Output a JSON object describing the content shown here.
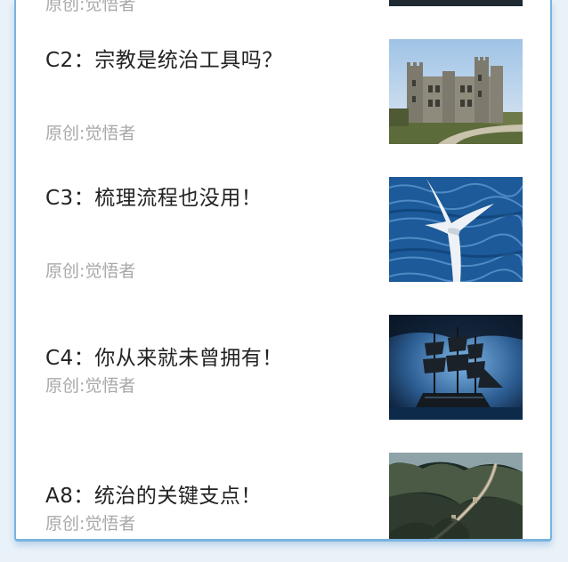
{
  "partial_item": {
    "author": "原创:觉悟者"
  },
  "articles": [
    {
      "title": "C2：宗教是统治工具吗？",
      "author": "原创:觉悟者",
      "thumbnail_icon": "castle-image"
    },
    {
      "title": "C3：梳理流程也没用！",
      "author": "原创:觉悟者",
      "thumbnail_icon": "seabird-image"
    },
    {
      "title": "C4：你从来就未曾拥有！",
      "author": "原创:觉悟者",
      "thumbnail_icon": "ship-image"
    },
    {
      "title": "A8：统治的关键支点！",
      "author": "原创:觉悟者",
      "thumbnail_icon": "great-wall-image"
    }
  ]
}
